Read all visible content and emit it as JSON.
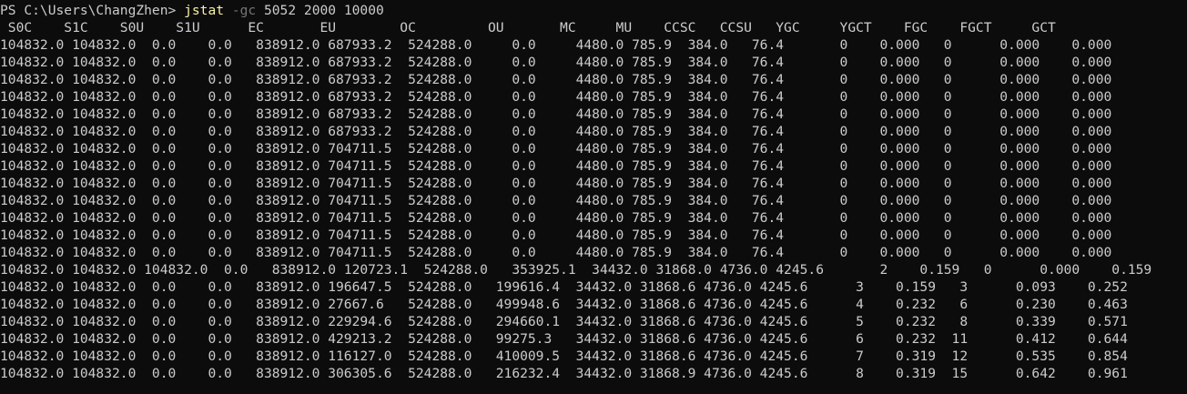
{
  "terminal": {
    "prompt": "PS C:\\Users\\ChangZhen> ",
    "command": "jstat",
    "flag": "-gc",
    "args": " 5052 2000 10000",
    "header": " S0C    S1C    S0U    S1U      EC       EU        OC         OU       MC     MU    CCSC   CCSU   YGC     YGCT    FGC    FGCT     GCT",
    "rows": [
      "104832.0 104832.0  0.0    0.0   838912.0 687933.2  524288.0     0.0     4480.0 785.9  384.0   76.4       0    0.000   0      0.000    0.000",
      "104832.0 104832.0  0.0    0.0   838912.0 687933.2  524288.0     0.0     4480.0 785.9  384.0   76.4       0    0.000   0      0.000    0.000",
      "104832.0 104832.0  0.0    0.0   838912.0 687933.2  524288.0     0.0     4480.0 785.9  384.0   76.4       0    0.000   0      0.000    0.000",
      "104832.0 104832.0  0.0    0.0   838912.0 687933.2  524288.0     0.0     4480.0 785.9  384.0   76.4       0    0.000   0      0.000    0.000",
      "104832.0 104832.0  0.0    0.0   838912.0 687933.2  524288.0     0.0     4480.0 785.9  384.0   76.4       0    0.000   0      0.000    0.000",
      "104832.0 104832.0  0.0    0.0   838912.0 687933.2  524288.0     0.0     4480.0 785.9  384.0   76.4       0    0.000   0      0.000    0.000",
      "104832.0 104832.0  0.0    0.0   838912.0 704711.5  524288.0     0.0     4480.0 785.9  384.0   76.4       0    0.000   0      0.000    0.000",
      "104832.0 104832.0  0.0    0.0   838912.0 704711.5  524288.0     0.0     4480.0 785.9  384.0   76.4       0    0.000   0      0.000    0.000",
      "104832.0 104832.0  0.0    0.0   838912.0 704711.5  524288.0     0.0     4480.0 785.9  384.0   76.4       0    0.000   0      0.000    0.000",
      "104832.0 104832.0  0.0    0.0   838912.0 704711.5  524288.0     0.0     4480.0 785.9  384.0   76.4       0    0.000   0      0.000    0.000",
      "104832.0 104832.0  0.0    0.0   838912.0 704711.5  524288.0     0.0     4480.0 785.9  384.0   76.4       0    0.000   0      0.000    0.000",
      "104832.0 104832.0  0.0    0.0   838912.0 704711.5  524288.0     0.0     4480.0 785.9  384.0   76.4       0    0.000   0      0.000    0.000",
      "104832.0 104832.0  0.0    0.0   838912.0 704711.5  524288.0     0.0     4480.0 785.9  384.0   76.4       0    0.000   0      0.000    0.000",
      "104832.0 104832.0 104832.0  0.0   838912.0 120723.1  524288.0   353925.1  34432.0 31868.0 4736.0 4245.6       2    0.159   0      0.000    0.159",
      "104832.0 104832.0  0.0    0.0   838912.0 196647.5  524288.0   199616.4  34432.0 31868.6 4736.0 4245.6      3    0.159   3      0.093    0.252",
      "104832.0 104832.0  0.0    0.0   838912.0 27667.6   524288.0   499948.6  34432.0 31868.6 4736.0 4245.6      4    0.232   6      0.230    0.463",
      "104832.0 104832.0  0.0    0.0   838912.0 229294.6  524288.0   294660.1  34432.0 31868.6 4736.0 4245.6      5    0.232   8      0.339    0.571",
      "104832.0 104832.0  0.0    0.0   838912.0 429213.2  524288.0   99275.3   34432.0 31868.6 4736.0 4245.6      6    0.232  11      0.412    0.644",
      "104832.0 104832.0  0.0    0.0   838912.0 116127.0  524288.0   410009.5  34432.0 31868.6 4736.0 4245.6      7    0.319  12      0.535    0.854",
      "104832.0 104832.0  0.0    0.0   838912.0 306305.6  524288.0   216232.4  34432.0 31868.9 4736.0 4245.6      8    0.319  15      0.642    0.961"
    ],
    "colors": {
      "background": "#0c0c0c",
      "text": "#cccccc",
      "command": "#f9f1a5",
      "flag": "#767676"
    }
  }
}
